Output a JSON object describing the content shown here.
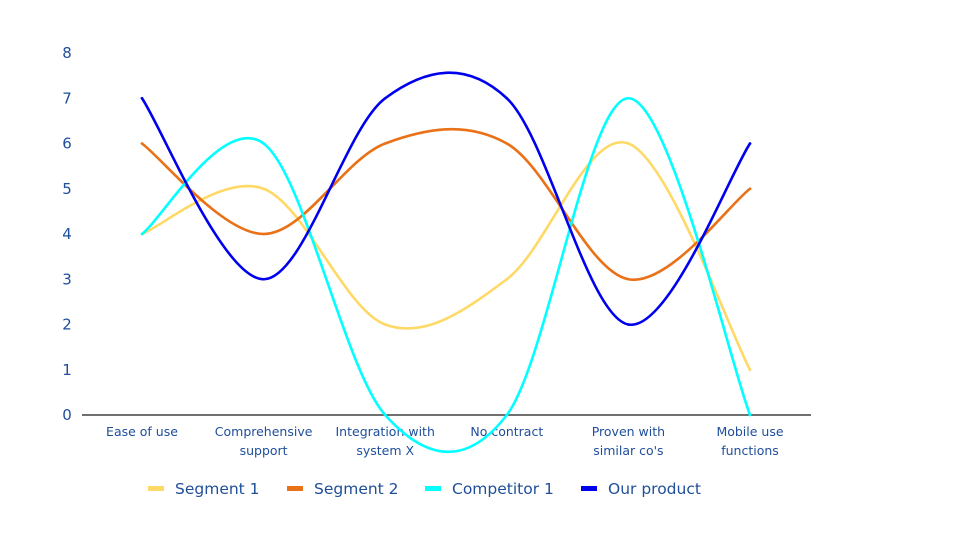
{
  "chart_data": {
    "type": "line",
    "smooth": true,
    "title": "",
    "xlabel": "",
    "ylabel": "",
    "ylim": [
      0,
      8
    ],
    "yticks": [
      0,
      1,
      2,
      3,
      4,
      5,
      6,
      7,
      8
    ],
    "grid": false,
    "legend_position": "bottom",
    "categories": [
      [
        "Ease of use"
      ],
      [
        "Comprehensive",
        "support"
      ],
      [
        "Integration with",
        "system X"
      ],
      [
        "No contract"
      ],
      [
        "Proven with",
        "similar co's"
      ],
      [
        "Mobile use",
        "functions"
      ]
    ],
    "series": [
      {
        "name": "Segment 1",
        "color": "#ffd966",
        "values": [
          4,
          5,
          2,
          3,
          6,
          1
        ]
      },
      {
        "name": "Segment 2",
        "color": "#e97117",
        "values": [
          6,
          4,
          6,
          6,
          3,
          5
        ]
      },
      {
        "name": "Competitor 1",
        "color": "#00ffff",
        "values": [
          4,
          6,
          0,
          0,
          7,
          0
        ]
      },
      {
        "name": "Our product",
        "color": "#0000ee",
        "values": [
          7,
          3,
          7,
          7,
          2,
          6
        ]
      }
    ],
    "axis_color": "#404040",
    "text_color": "#1f4e9a"
  }
}
